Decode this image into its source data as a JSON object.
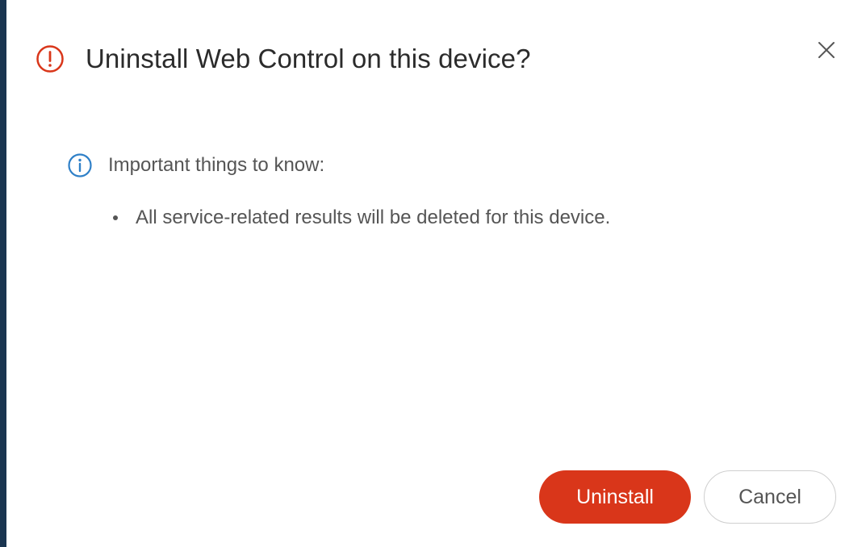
{
  "dialog": {
    "title": "Uninstall Web Control on this device?",
    "title_icon": "exclamation-circle-icon",
    "close_icon": "close-icon",
    "info": {
      "icon": "info-circle-icon",
      "heading": "Important things to know:",
      "bullets": [
        "All service-related results will be deleted for this device."
      ]
    },
    "actions": {
      "primary_label": "Uninstall",
      "secondary_label": "Cancel"
    }
  },
  "colors": {
    "danger": "#d9361a",
    "info": "#2f80c8",
    "text_primary": "#2b2b2b",
    "text_secondary": "#555555",
    "side_bar": "#1a3550"
  }
}
